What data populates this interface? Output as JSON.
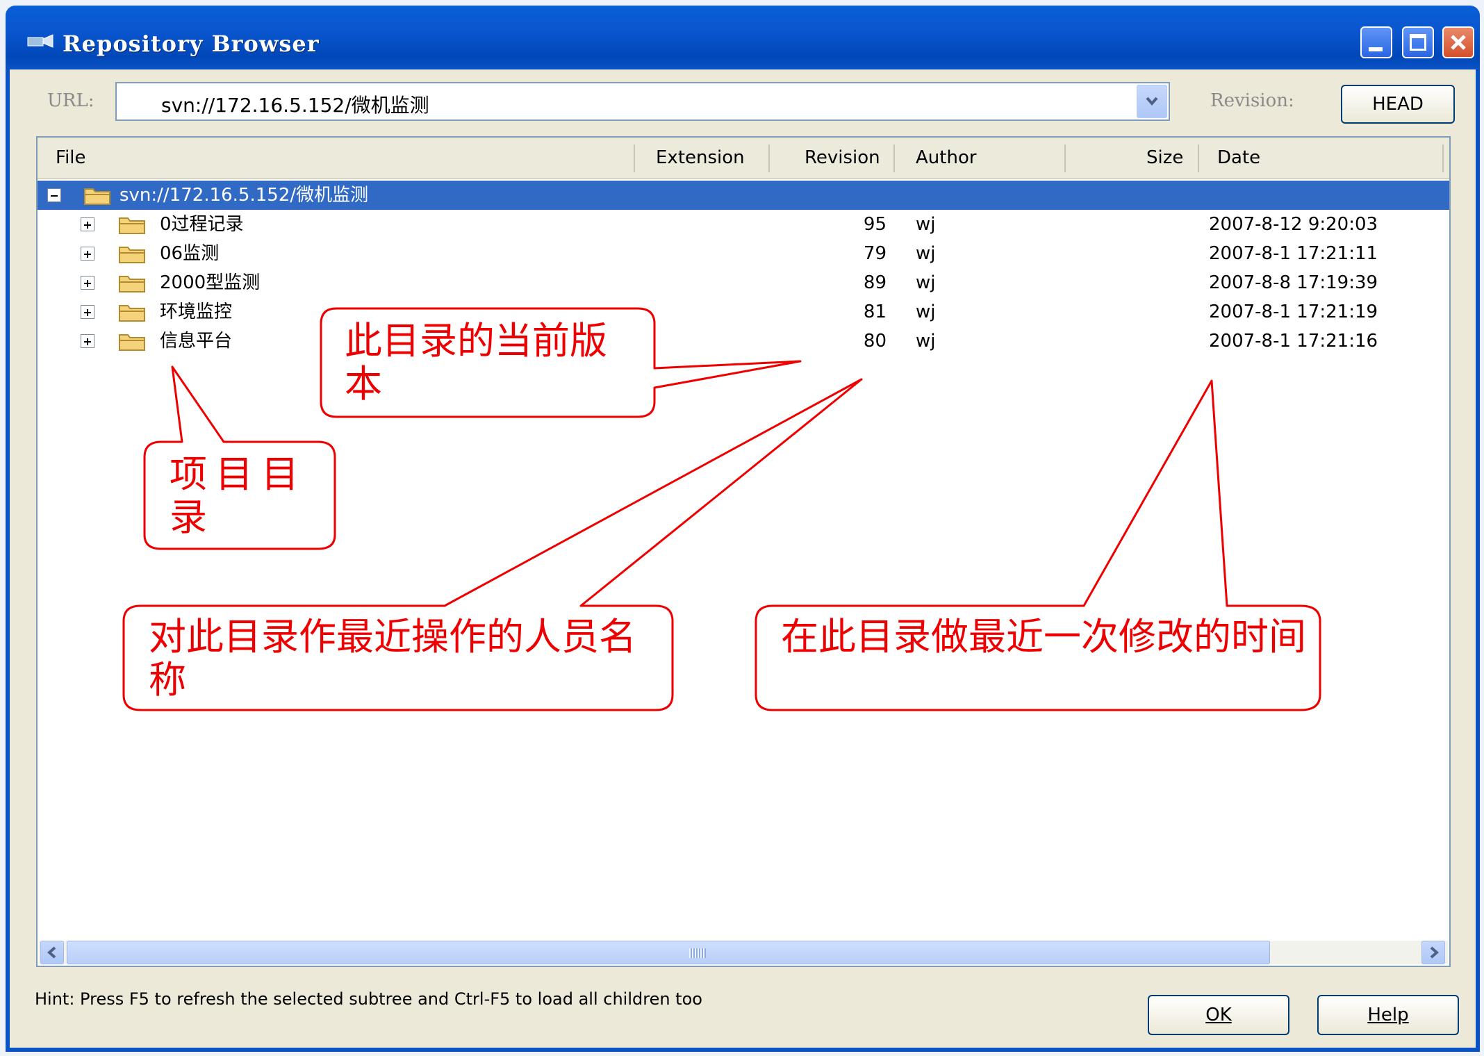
{
  "window": {
    "title": "Repository Browser"
  },
  "url_bar": {
    "label": "URL:",
    "value": "svn://172.16.5.152/微机监测",
    "revision_label": "Revision:",
    "revision_button": "HEAD"
  },
  "columns": [
    "File",
    "Extension",
    "Revision",
    "Author",
    "Size",
    "Date"
  ],
  "root": {
    "name": "svn://172.16.5.152/微机监测"
  },
  "rows": [
    {
      "name": "0过程记录",
      "revision": "95",
      "author": "wj",
      "date": "2007-8-12 9:20:03"
    },
    {
      "name": "06监测",
      "revision": "79",
      "author": "wj",
      "date": "2007-8-1 17:21:11"
    },
    {
      "name": "2000型监测",
      "revision": "89",
      "author": "wj",
      "date": "2007-8-8 17:19:39"
    },
    {
      "name": "环境监控",
      "revision": "81",
      "author": "wj",
      "date": "2007-8-1 17:21:19"
    },
    {
      "name": "信息平台",
      "revision": "80",
      "author": "wj",
      "date": "2007-8-1 17:21:16"
    }
  ],
  "hint": "Hint: Press F5 to refresh the selected subtree and Ctrl-F5 to load all children too",
  "buttons": {
    "ok": "OK",
    "help": "Help"
  },
  "annotations": {
    "revision_note": "此目录的当前版本",
    "project_dir_note": "项目目录",
    "author_note": "对此目录作最近操作的人员名称",
    "date_note": "在此目录做最近一次修改的时间"
  },
  "colors": {
    "titlebar": "#0a56cf",
    "selection": "#316ac5",
    "annotation": "#ee0000"
  }
}
